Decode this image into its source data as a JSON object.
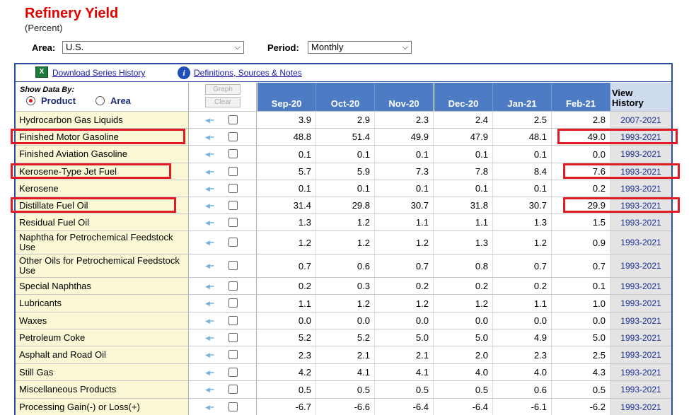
{
  "page": {
    "title": "Refinery Yield",
    "subtitle": "(Percent)",
    "area_label": "Area:",
    "area_value": "U.S.",
    "period_label": "Period:",
    "period_value": "Monthly"
  },
  "toolbar": {
    "download_label": "Download Series History",
    "definitions_label": "Definitions, Sources & Notes"
  },
  "controls": {
    "show_data_by": "Show Data By:",
    "product_label": "Product",
    "area_label": "Area",
    "graph_label": "Graph",
    "clear_label": "Clear"
  },
  "table": {
    "months": [
      "Sep-20",
      "Oct-20",
      "Nov-20",
      "Dec-20",
      "Jan-21",
      "Feb-21"
    ],
    "view_history_line1": "View",
    "view_history_line2": "History",
    "rows": [
      {
        "name": "Hydrocarbon Gas Liquids",
        "values": [
          "3.9",
          "2.9",
          "2.3",
          "2.4",
          "2.5",
          "2.8"
        ],
        "history": "2007-2021"
      },
      {
        "name": "Finished Motor Gasoline",
        "values": [
          "48.8",
          "51.4",
          "49.9",
          "47.9",
          "48.1",
          "49.0"
        ],
        "history": "1993-2021"
      },
      {
        "name": "Finished Aviation Gasoline",
        "values": [
          "0.1",
          "0.1",
          "0.1",
          "0.1",
          "0.1",
          "0.0"
        ],
        "history": "1993-2021"
      },
      {
        "name": "Kerosene-Type Jet Fuel",
        "values": [
          "5.7",
          "5.9",
          "7.3",
          "7.8",
          "8.4",
          "7.6"
        ],
        "history": "1993-2021"
      },
      {
        "name": "Kerosene",
        "values": [
          "0.1",
          "0.1",
          "0.1",
          "0.1",
          "0.1",
          "0.2"
        ],
        "history": "1993-2021"
      },
      {
        "name": "Distillate Fuel Oil",
        "values": [
          "31.4",
          "29.8",
          "30.7",
          "31.8",
          "30.7",
          "29.9"
        ],
        "history": "1993-2021"
      },
      {
        "name": "Residual Fuel Oil",
        "values": [
          "1.3",
          "1.2",
          "1.1",
          "1.1",
          "1.3",
          "1.5"
        ],
        "history": "1993-2021"
      },
      {
        "name": "Naphtha for Petrochemical Feedstock Use",
        "values": [
          "1.2",
          "1.2",
          "1.2",
          "1.3",
          "1.2",
          "0.9"
        ],
        "history": "1993-2021"
      },
      {
        "name": "Other Oils for Petrochemical Feedstock Use",
        "values": [
          "0.7",
          "0.6",
          "0.7",
          "0.8",
          "0.7",
          "0.7"
        ],
        "history": "1993-2021"
      },
      {
        "name": "Special Naphthas",
        "values": [
          "0.2",
          "0.3",
          "0.2",
          "0.2",
          "0.2",
          "0.1"
        ],
        "history": "1993-2021"
      },
      {
        "name": "Lubricants",
        "values": [
          "1.1",
          "1.2",
          "1.2",
          "1.2",
          "1.1",
          "1.0"
        ],
        "history": "1993-2021"
      },
      {
        "name": "Waxes",
        "values": [
          "0.0",
          "0.0",
          "0.0",
          "0.0",
          "0.0",
          "0.0"
        ],
        "history": "1993-2021"
      },
      {
        "name": "Petroleum Coke",
        "values": [
          "5.2",
          "5.2",
          "5.0",
          "5.0",
          "4.9",
          "5.0"
        ],
        "history": "1993-2021"
      },
      {
        "name": "Asphalt and Road Oil",
        "values": [
          "2.3",
          "2.1",
          "2.1",
          "2.0",
          "2.3",
          "2.5"
        ],
        "history": "1993-2021"
      },
      {
        "name": "Still Gas",
        "values": [
          "4.2",
          "4.1",
          "4.1",
          "4.0",
          "4.0",
          "4.3"
        ],
        "history": "1993-2021"
      },
      {
        "name": "Miscellaneous Products",
        "values": [
          "0.5",
          "0.5",
          "0.5",
          "0.5",
          "0.6",
          "0.5"
        ],
        "history": "1993-2021"
      },
      {
        "name": "Processing Gain(-) or Loss(+)",
        "values": [
          "-6.7",
          "-6.6",
          "-6.4",
          "-6.4",
          "-6.1",
          "-6.2"
        ],
        "history": "1993-2021"
      }
    ]
  },
  "highlights": {
    "color": "#e01b24",
    "rows": [
      "Finished Motor Gasoline",
      "Kerosene-Type Jet Fuel",
      "Distillate Fuel Oil"
    ]
  },
  "icons": {
    "excel": "excel-icon",
    "info": "info-icon",
    "key": "key-icon",
    "chevron": "chevron-down-icon"
  }
}
